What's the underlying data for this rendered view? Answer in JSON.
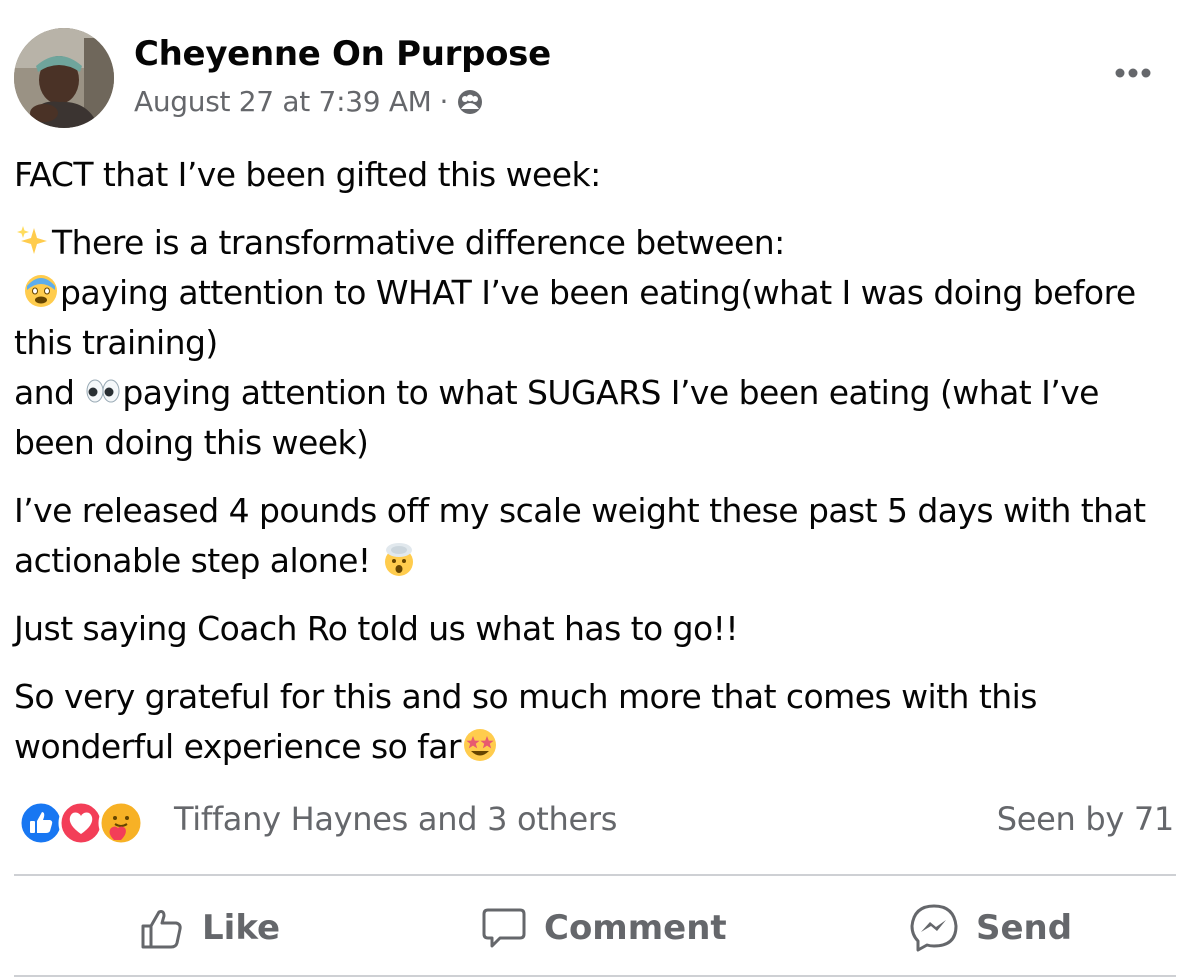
{
  "post": {
    "author": "Cheyenne On Purpose",
    "timestamp": "August 27 at 7:39 AM",
    "separator": "·",
    "audience_icon": "group-icon",
    "more_icon": "more-dots-icon",
    "lines": {
      "l1": "FACT that I’ve been gifted this week:",
      "l2": "There is a transformative difference between:",
      "l3": "paying attention to WHAT I’ve been eating(what I was doing before this training)",
      "l4a": "and ",
      "l4b": "paying attention to what SUGARS I’ve been eating (what I’ve been doing this week)",
      "l5": "I’ve released 4 pounds off my scale weight these past 5 days with that actionable step alone! ",
      "l6": "Just saying Coach Ro told us what has to go!!",
      "l7": "So very grateful for this and so much more that comes with this wonderful experience so far"
    },
    "emojis": [
      "sparkles-emoji",
      "fearful-face-emoji",
      "eyes-emoji",
      "exploding-head-emoji",
      "star-struck-emoji"
    ]
  },
  "reactions": {
    "icons": [
      "like-reaction-icon",
      "love-reaction-icon",
      "care-reaction-icon"
    ],
    "summary": "Tiffany Haynes and 3 others",
    "seen": "Seen by 71"
  },
  "actions": [
    {
      "label": "Like",
      "icon": "thumbs-up-icon"
    },
    {
      "label": "Comment",
      "icon": "comment-bubble-icon"
    },
    {
      "label": "Send",
      "icon": "messenger-icon"
    }
  ],
  "colors": {
    "text": "#050505",
    "secondary": "#65676b",
    "like_blue": "#1877f2",
    "love_red": "#f33e58",
    "divider": "#ced0d4"
  }
}
